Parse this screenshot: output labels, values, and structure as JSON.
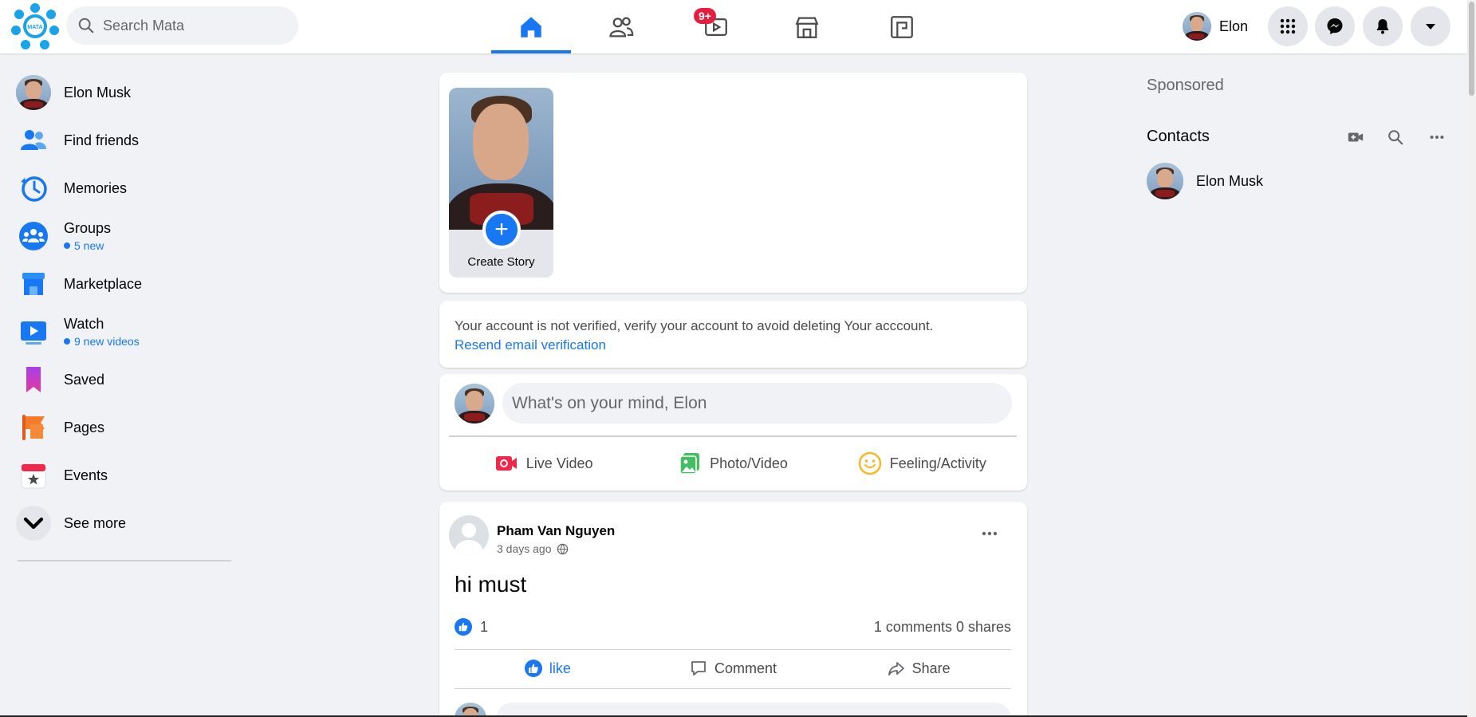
{
  "topbar": {
    "logo_text": "MATA",
    "search_placeholder": "Search Mata",
    "nav_tabs": [
      {
        "name": "home",
        "active": true
      },
      {
        "name": "friends",
        "active": false
      },
      {
        "name": "watch",
        "active": false,
        "badge": "9+"
      },
      {
        "name": "marketplace",
        "active": false
      },
      {
        "name": "gaming",
        "active": false
      }
    ],
    "profile_name": "Elon",
    "buttons": [
      "menu-grid",
      "messenger",
      "notifications",
      "account-dropdown"
    ]
  },
  "sidebar": {
    "items": [
      {
        "label": "Elon Musk",
        "icon": "avatar"
      },
      {
        "label": "Find friends",
        "icon": "friends-icon"
      },
      {
        "label": "Memories",
        "icon": "memories-icon"
      },
      {
        "label": "Groups",
        "sub": "5 new",
        "icon": "groups-icon"
      },
      {
        "label": "Marketplace",
        "icon": "marketplace-icon"
      },
      {
        "label": "Watch",
        "sub": "9 new videos",
        "icon": "watch-icon"
      },
      {
        "label": "Saved",
        "icon": "saved-icon"
      },
      {
        "label": "Pages",
        "icon": "pages-icon"
      },
      {
        "label": "Events",
        "icon": "events-icon"
      },
      {
        "label": "See more",
        "icon": "chevron-down-icon"
      }
    ]
  },
  "story": {
    "label": "Create Story"
  },
  "verify": {
    "message": "Your account is not verified, verify your account to avoid deleting Your acccount.",
    "link": "Resend email verification"
  },
  "composer": {
    "placeholder": "What's on your mind, Elon",
    "actions": [
      "Live Video",
      "Photo/Video",
      "Feeling/Activity"
    ]
  },
  "post": {
    "author": "Pham Van Nguyen",
    "time": "3 days ago",
    "text": "hi must",
    "like_count": "1",
    "stats": "1 comments 0 shares",
    "actions": [
      "like",
      "Comment",
      "Share"
    ]
  },
  "right": {
    "sponsored": "Sponsored",
    "contacts_title": "Contacts",
    "contacts": [
      {
        "name": "Elon Musk"
      }
    ]
  },
  "colors": {
    "accent": "#1877f2",
    "badge": "#e41e3f",
    "background": "#f0f2f5"
  }
}
